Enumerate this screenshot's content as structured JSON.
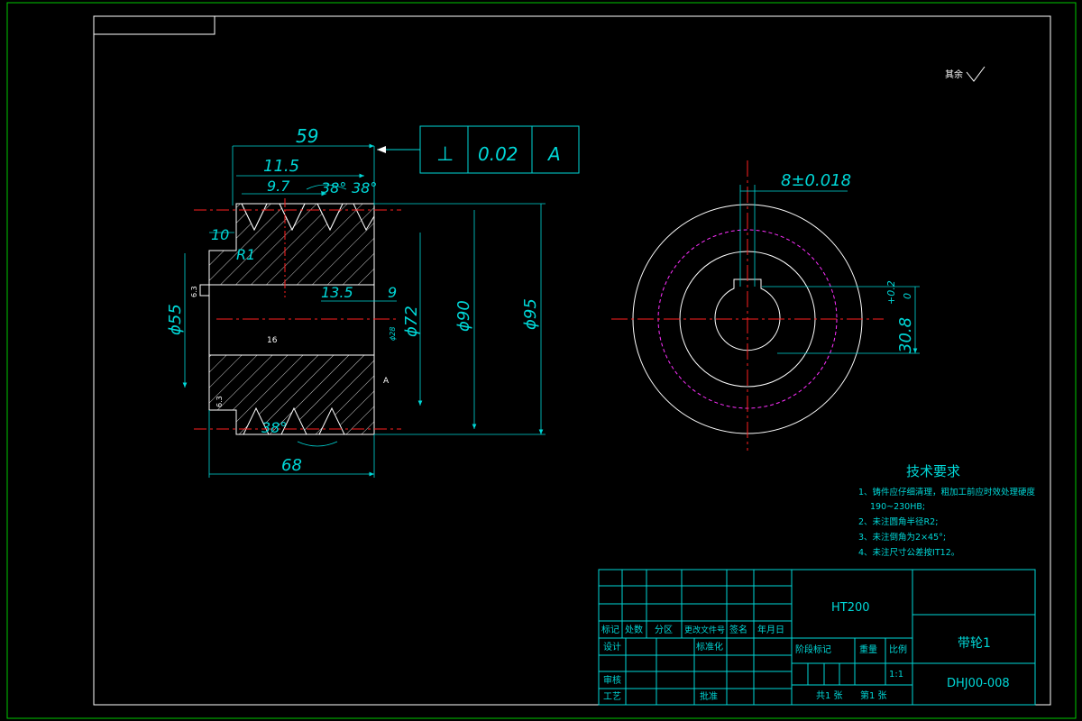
{
  "drawing": {
    "roughness_note": "其余",
    "dimensions": {
      "len_59": "59",
      "len_11_5": "11.5",
      "len_9_7": "9.7",
      "angle_38a": "38°",
      "angle_38b": "38°",
      "len_10": "10",
      "radius_r1": "R1",
      "len_13_5": "13.5",
      "len_9": "9",
      "dia_55": "ϕ55",
      "dia_72": "ϕ72",
      "dia_90": "ϕ90",
      "dia_95": "ϕ95",
      "len_68": "68",
      "angle_38c": "38°",
      "keyway_width": "8±0.018",
      "keyway_depth": "30.8",
      "keyway_depth_tol_upper": "+0.2",
      "keyway_depth_tol_lower": "0",
      "bore_dia_small": "ϕ28",
      "roughness_16": "16",
      "roughness_6_3": "6.3",
      "datum_a_flag": "A"
    },
    "tolerance_frame": {
      "symbol": "⊥",
      "value": "0.02",
      "datum": "A"
    }
  },
  "tech_requirements": {
    "title": "技术要求",
    "items": [
      "1、铸件应仔细清理，粗加工前应时效处理硬度",
      "190~230HB;",
      "2、未注圆角半径R2;",
      "3、未注倒角为2×45°;",
      "4、未注尺寸公差按IT12。"
    ]
  },
  "title_block": {
    "material": "HT200",
    "part_name": "带轮1",
    "drawing_no": "DHJ00-008",
    "scale": "1:1",
    "headers": [
      "标记",
      "处数",
      "分区",
      "更改文件号",
      "签名",
      "年月日"
    ],
    "design": "设计",
    "standardization": "标准化",
    "review": "审核",
    "process": "工艺",
    "approve": "批准",
    "stage_mark": "阶段标记",
    "weight": "重量",
    "scale_label": "比例",
    "sheets_total": "共1 张",
    "sheet_no": "第1 张"
  },
  "colors": {
    "outline": "#ffffff",
    "dimension": "#00d7d7",
    "center": "#ff2020",
    "pitch": "#ff30ff",
    "frame": "#00c800"
  }
}
